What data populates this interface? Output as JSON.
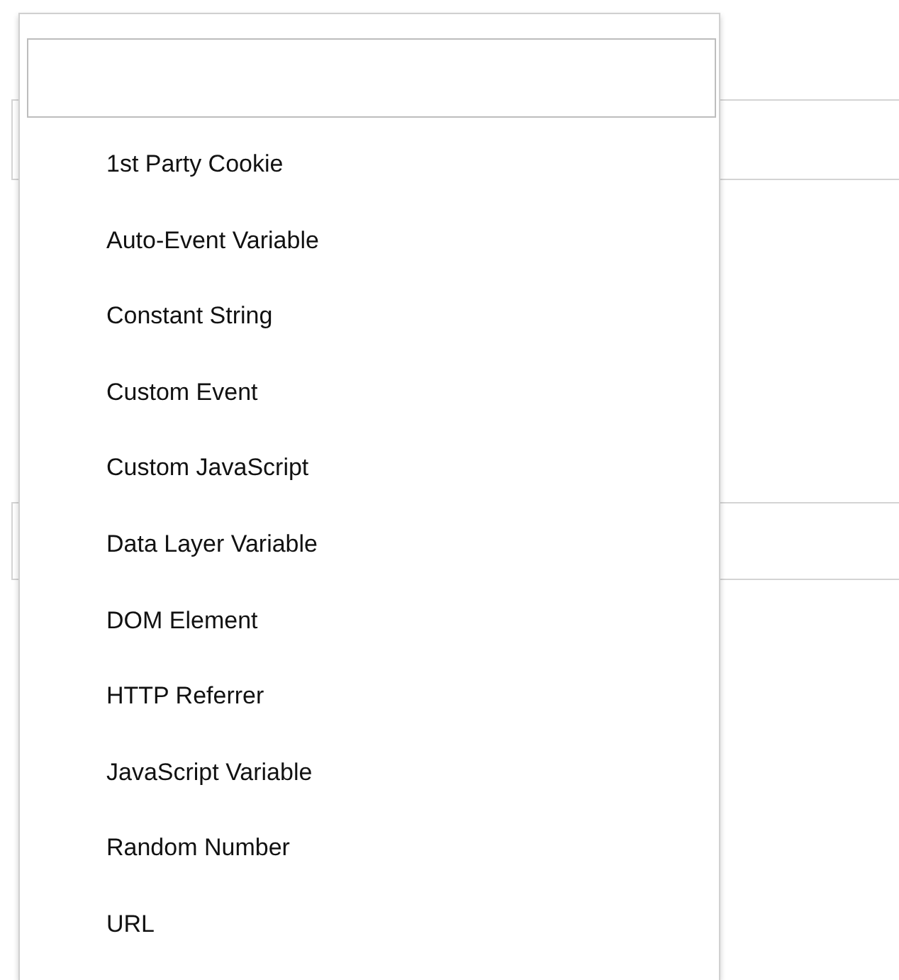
{
  "dropdown": {
    "options": [
      {
        "label": "1st Party Cookie",
        "selected": false
      },
      {
        "label": "Auto-Event Variable",
        "selected": false
      },
      {
        "label": "Constant String",
        "selected": false
      },
      {
        "label": "Custom Event",
        "selected": false
      },
      {
        "label": "Custom JavaScript",
        "selected": false
      },
      {
        "label": "Data Layer Variable",
        "selected": false
      },
      {
        "label": "DOM Element",
        "selected": false
      },
      {
        "label": "HTTP Referrer",
        "selected": false
      },
      {
        "label": "JavaScript Variable",
        "selected": false
      },
      {
        "label": "Random Number",
        "selected": false
      },
      {
        "label": "URL",
        "selected": false
      }
    ]
  }
}
